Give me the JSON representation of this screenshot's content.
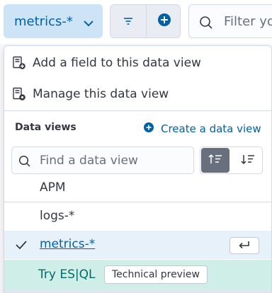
{
  "toolbar": {
    "data_view_button_label": "metrics-*",
    "query_placeholder": "Filter yo"
  },
  "menu": {
    "add_field_label": "Add a field to this data view",
    "manage_label": "Manage this data view"
  },
  "data_views": {
    "section_title": "Data views",
    "create_label": "Create a data view",
    "find_placeholder": "Find a data view",
    "items": [
      {
        "label": "APM",
        "selected": false
      },
      {
        "label": "logs-*",
        "selected": false
      },
      {
        "label": "metrics-*",
        "selected": true
      }
    ]
  },
  "esql": {
    "label": "Try ES|QL",
    "badge": "Technical preview"
  },
  "colors": {
    "accent": "#0061a6",
    "selected_bg": "#e6f1fa",
    "esql_bg": "#cfeee8",
    "esql_text": "#006c66"
  },
  "icons": {
    "chevron": "chevron-down-icon",
    "filter": "filter-menu-icon",
    "add_filter": "plus-circle-icon",
    "search": "search-icon",
    "add_field": "add-field-icon",
    "manage": "manage-data-view-icon",
    "sort_asc": "sort-ascending-icon",
    "sort_desc": "sort-descending-icon",
    "check": "check-icon",
    "enter": "enter-key-icon"
  }
}
